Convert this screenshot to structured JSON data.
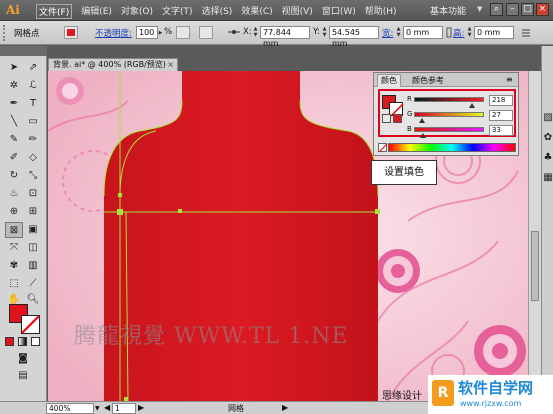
{
  "app": {
    "logo": "Ai",
    "workspace": "基本功能"
  },
  "menu": [
    "文件(F)",
    "编辑(E)",
    "对象(O)",
    "文字(T)",
    "选择(S)",
    "效果(C)",
    "视图(V)",
    "窗口(W)",
    "帮助(H)"
  ],
  "control": {
    "tool_name": "网格点",
    "opacity_label": "不透明度:",
    "opacity_value": "100",
    "percent": "%",
    "x_label": "X:",
    "x_value": "77.844 mm",
    "y_label": "Y:",
    "y_value": "54.545 mm",
    "w_label": "宽:",
    "w_value": "0 mm",
    "h_label": "高:",
    "h_value": "0 mm"
  },
  "document": {
    "tab": "背景. ai* @ 400% (RGB/预览)"
  },
  "color_panel": {
    "tab_color": "颜色",
    "tab_guide": "颜色参考",
    "r_label": "R",
    "r_value": "218",
    "g_label": "G",
    "g_value": "27",
    "b_label": "B",
    "b_value": "33",
    "fill_color": "#da1b21"
  },
  "callout": "设置填色",
  "status": {
    "zoom": "400%",
    "artboard": "1",
    "tool": "网格"
  },
  "watermark": "腾龍視覺 WWW.TL 1.NE",
  "caption": "思缘设计",
  "brand": {
    "logo": "R",
    "name": "软件自学网",
    "url": "www.rjzxw.com"
  }
}
